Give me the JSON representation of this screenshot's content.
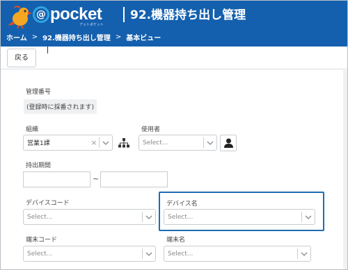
{
  "header": {
    "logo_text": "pocket",
    "logo_at": "@",
    "logo_subtitle": "アットポケット",
    "app_title": "92.機器持ち出し管理"
  },
  "breadcrumb": {
    "items": [
      "ホーム",
      "92.機器持ち出し管理",
      "基本ビュー"
    ],
    "separator": ">"
  },
  "toolbar": {
    "back_label": "戻る"
  },
  "form": {
    "management_number": {
      "label": "管理番号",
      "value": "(登録時に採番されます)"
    },
    "organization": {
      "label": "組織",
      "value": "営業1課",
      "clear": "×"
    },
    "user": {
      "label": "使用者",
      "placeholder": "Select..."
    },
    "period": {
      "label": "持出期間",
      "separator": "~",
      "start_value": "",
      "end_value": ""
    },
    "device_code": {
      "label": "デバイスコード",
      "placeholder": "Select..."
    },
    "device_name": {
      "label": "デバイス名",
      "placeholder": "Select..."
    },
    "terminal_code": {
      "label": "端末コード",
      "placeholder": "Select..."
    },
    "terminal_name": {
      "label": "端末名",
      "placeholder": "Select..."
    }
  },
  "colors": {
    "header_bg": "#1460ae",
    "focus_border": "#1d6cb3",
    "field_border": "#c8ccd1"
  },
  "icons": [
    "bird-logo-icon",
    "org-tree-icon",
    "person-icon",
    "chevron-down-icon",
    "clear-icon"
  ]
}
